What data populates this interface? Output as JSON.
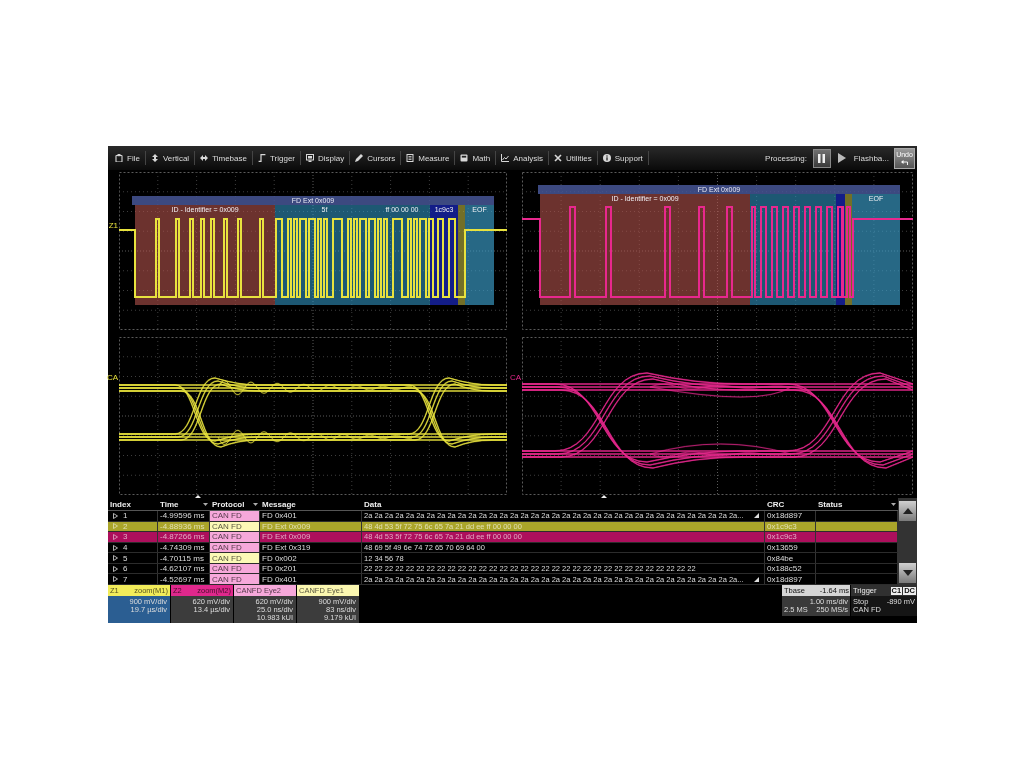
{
  "menu_bar": {
    "items": [
      "File",
      "Vertical",
      "Timebase",
      "Trigger",
      "Display",
      "Cursors",
      "Measure",
      "Math",
      "Analysis",
      "Utilities",
      "Support"
    ],
    "processing_label": "Processing:",
    "flashback_label": "Flashba...",
    "undo_label": "Undo"
  },
  "grids": [
    {
      "kind": "decode",
      "color": "#e8e23e",
      "trace_label": "Z1",
      "decode": {
        "title": "FD Ext 0x009",
        "segments": [
          {
            "kind": "id",
            "label": "ID - Identifier = 0x009"
          },
          {
            "kind": "data",
            "label": "5f"
          },
          {
            "kind": "data",
            "label": "ff 00 00 00"
          },
          {
            "kind": "crc",
            "label": "1c9c3"
          },
          {
            "kind": "ack"
          },
          {
            "kind": "eof",
            "label": "EOF"
          }
        ]
      }
    },
    {
      "kind": "decode",
      "color": "#e8288e",
      "decode": {
        "title": "FD Ext 0x009",
        "segments": [
          {
            "kind": "id",
            "label": "ID - Identifier = 0x009"
          },
          {
            "kind": "data"
          },
          {
            "kind": "crc"
          },
          {
            "kind": "ack"
          },
          {
            "kind": "eof",
            "label": "EOF"
          }
        ]
      }
    },
    {
      "kind": "eye",
      "color": "#e8e23e",
      "trace_label": "CA"
    },
    {
      "kind": "eye",
      "color": "#e8288e",
      "trace_label": "CA"
    }
  ],
  "table": {
    "columns": [
      {
        "label": "Index",
        "filter": false
      },
      {
        "label": "Time",
        "filter": true
      },
      {
        "label": "Protocol",
        "filter": true
      },
      {
        "label": "Message",
        "filter": false
      },
      {
        "label": "Data",
        "filter": false
      },
      {
        "label": "CRC",
        "filter": false
      },
      {
        "label": "Status",
        "filter": true
      }
    ],
    "rows": [
      {
        "index": "1",
        "time": "-4.99596 ms",
        "protocol": {
          "label": "CAN FD",
          "color": "#f6a8da"
        },
        "message": "FD 0x401",
        "data": "2a 2a 2a 2a 2a 2a 2a 2a 2a 2a 2a 2a 2a 2a 2a 2a 2a 2a 2a 2a 2a 2a 2a 2a 2a 2a 2a 2a 2a 2a 2a 2a 2a 2a 2a 2a...",
        "truncated": true,
        "crc": "0x18d897"
      },
      {
        "index": "2",
        "time": "-4.88936 ms",
        "protocol": {
          "label": "CAN FD",
          "color": "#fcf9b6"
        },
        "message": "FD Ext 0x009",
        "data": "48 4d 53 5f 72 75 6c 65 7a 21 dd ee ff 00 00 00",
        "truncated": false,
        "crc": "0x1c9c3",
        "color": "#aaa52a"
      },
      {
        "index": "3",
        "time": "-4.87266 ms",
        "protocol": {
          "label": "CAN FD",
          "color": "#f6a8da"
        },
        "message": "FD Ext 0x009",
        "data": "48 4d 53 5f 72 75 6c 65 7a 21 dd ee ff 00 00 00",
        "truncated": false,
        "crc": "0x1c9c3",
        "color": "#ad0f5c"
      },
      {
        "index": "4",
        "time": "-4.74309 ms",
        "protocol": {
          "label": "CAN FD",
          "color": "#f6a8da"
        },
        "message": "FD Ext 0x319",
        "data": "48 69 5f 49 6e 74 72 65 70 69 64 00",
        "truncated": false,
        "crc": "0x13659"
      },
      {
        "index": "5",
        "time": "-4.70115 ms",
        "protocol": {
          "label": "CAN FD",
          "color": "#fcf9b6"
        },
        "message": "FD 0x002",
        "data": "12 34 56 78",
        "truncated": false,
        "crc": "0x84be"
      },
      {
        "index": "6",
        "time": "-4.62107 ms",
        "protocol": {
          "label": "CAN FD",
          "color": "#f6a8da"
        },
        "message": "FD 0x201",
        "data": "22 22 22 22 22 22 22 22 22 22 22 22 22 22 22 22 22 22 22 22 22 22 22 22 22 22 22 22 22 22 22 22",
        "truncated": false,
        "crc": "0x188c52"
      },
      {
        "index": "7",
        "time": "-4.52697 ms",
        "protocol": {
          "label": "CAN FD",
          "color": "#f6a8da"
        },
        "message": "FD 0x401",
        "data": "2a 2a 2a 2a 2a 2a 2a 2a 2a 2a 2a 2a 2a 2a 2a 2a 2a 2a 2a 2a 2a 2a 2a 2a 2a 2a 2a 2a 2a 2a 2a 2a 2a 2a 2a 2a...",
        "truncated": true,
        "crc": "0x18d897"
      }
    ]
  },
  "descriptors": [
    {
      "label": "Z1",
      "title": "zoom(M1)",
      "color": "#f2ec5a",
      "selected": true,
      "lines": [
        "900 mV/div",
        "19.7 µs/div"
      ]
    },
    {
      "label": "Z2",
      "title": "zoom(M2)",
      "color": "#e0288c",
      "selected": false,
      "lines": [
        "620 mV/div",
        "13.4 µs/div"
      ]
    },
    {
      "title": "CANFD Eye2",
      "color": "#f6a8da",
      "selected": false,
      "lines": [
        "620 mV/div",
        "25.0 ns/div",
        "10.983 kUI"
      ]
    },
    {
      "title": "CANFD Eye1",
      "color": "#fbf7b0",
      "selected": false,
      "lines": [
        "900 mV/div",
        "83 ns/div",
        "9.179 kUI"
      ]
    }
  ],
  "status_boxes": [
    {
      "kind": "timebase",
      "label": "Tbase",
      "value": "-1.64 ms",
      "rows": [
        {
          "right": "1.00 ms/div"
        },
        {
          "left": "2.5 MS",
          "right": "250 MS/s"
        }
      ]
    },
    {
      "kind": "trigger",
      "label": "Trigger",
      "badges": [
        "C1",
        "DC"
      ],
      "rows": [
        {
          "left": "Stop",
          "right": "-890 mV"
        },
        {
          "left": "CAN FD"
        }
      ]
    }
  ]
}
